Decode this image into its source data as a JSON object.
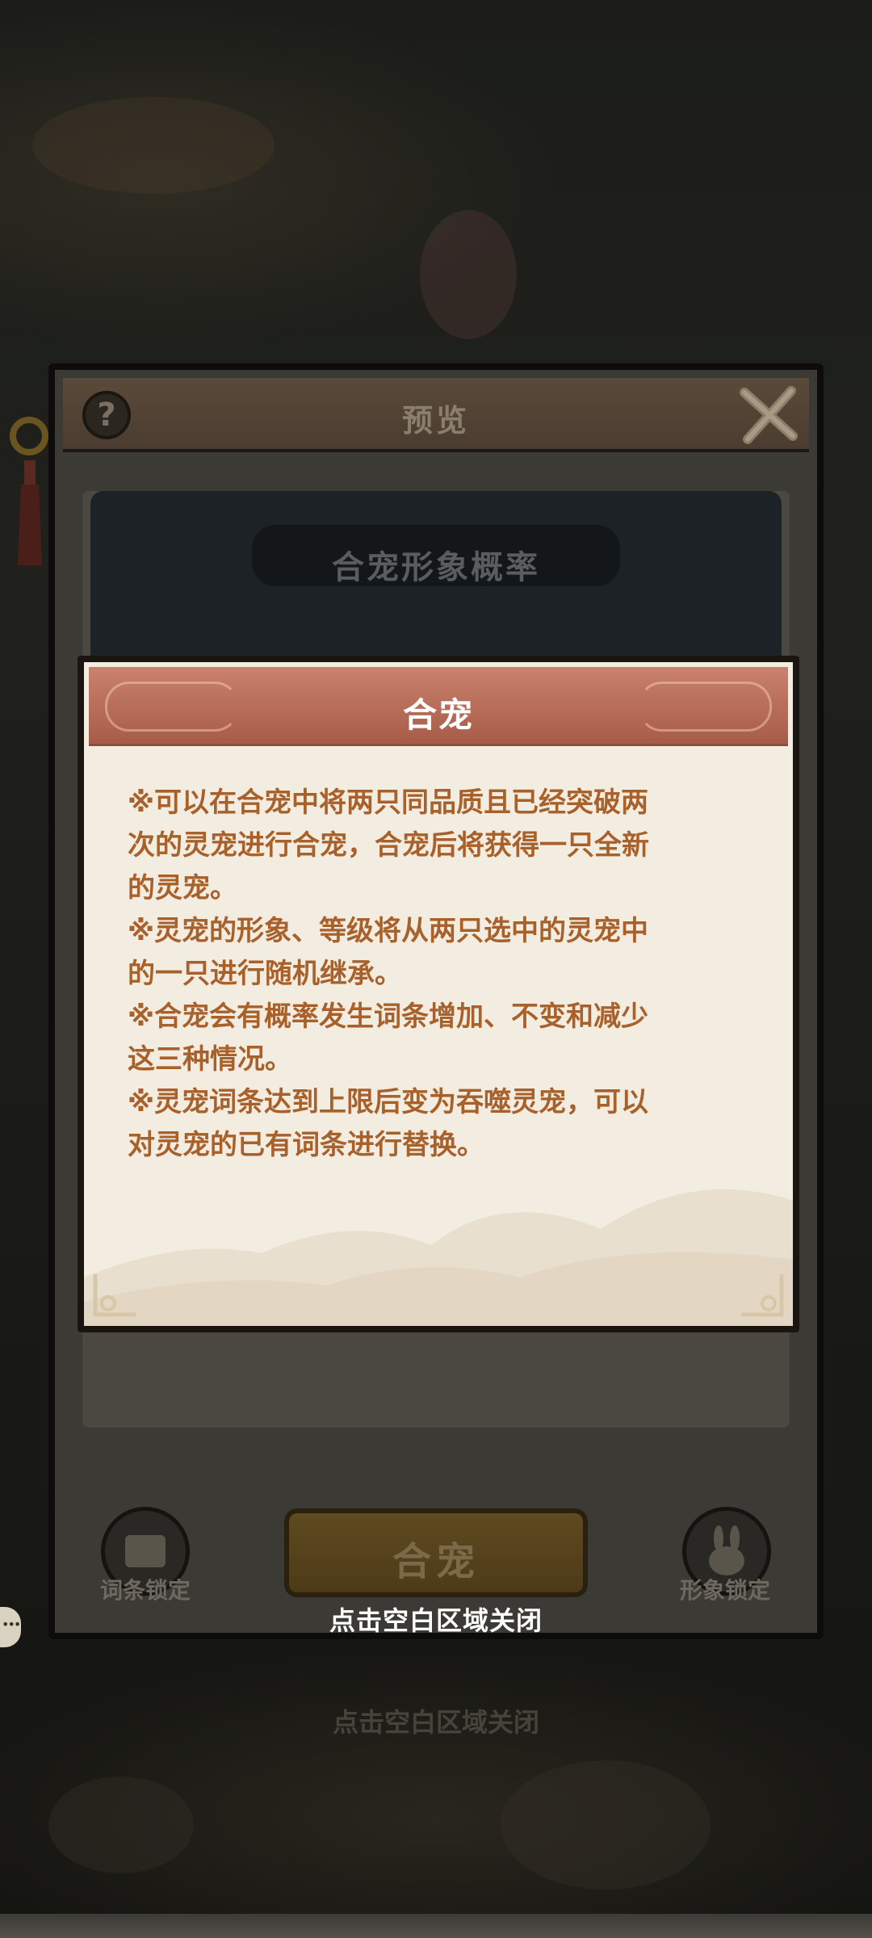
{
  "preview_dialog": {
    "title": "预览",
    "probability_title": "合宠形象概率",
    "merge_button_label": "合宠",
    "left_button_label": "词条锁定",
    "right_button_label": "形象锁定"
  },
  "info_popup": {
    "title": "合宠",
    "lines": [
      "※可以在合宠中将两只同品质且已经突破两",
      "次的灵宠进行合宠，合宠后将获得一只全新",
      "的灵宠。",
      "※灵宠的形象、等级将从两只选中的灵宠中",
      "的一只进行随机继承。",
      "※合宠会有概率发生词条增加、不变和减少",
      "这三种情况。",
      "※灵宠词条达到上限后变为吞噬灵宠，可以",
      "对灵宠的已有词条进行替换。"
    ]
  },
  "close_hint": "点击空白区域关闭",
  "background_close_hint": "点击空白区域关闭",
  "colors": {
    "popup_header": "#b56b56",
    "popup_body": "#f3ece0",
    "popup_text": "#a8612b",
    "overlay_bg": "#151512"
  },
  "icons": {
    "help": "question-icon",
    "close": "close-x-icon",
    "left_round": "scroll-lock-icon",
    "right_round": "rabbit-lock-icon"
  }
}
